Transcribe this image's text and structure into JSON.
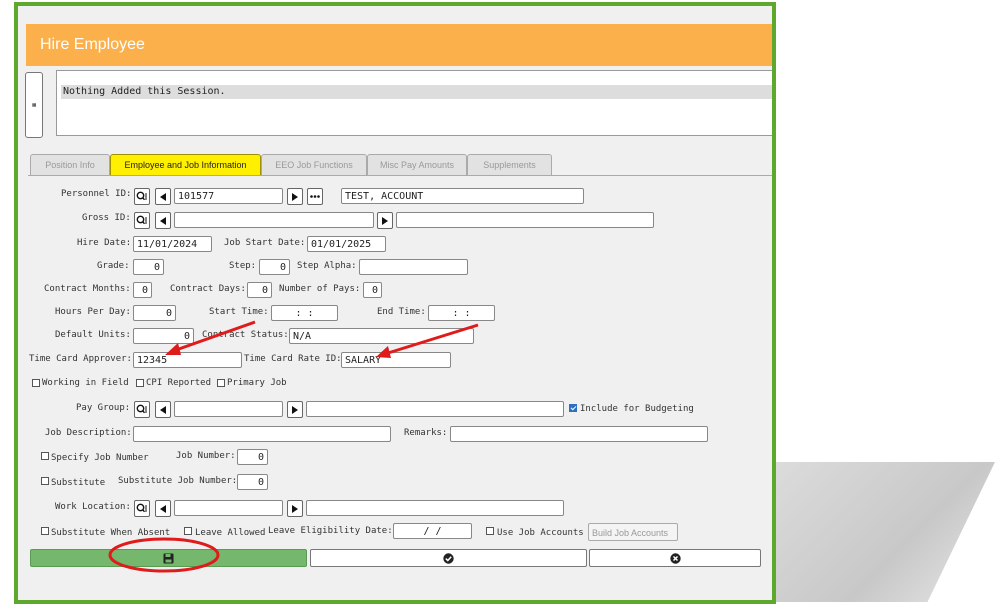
{
  "window": {
    "title": "Hire Employee"
  },
  "session": {
    "message": "Nothing Added this Session."
  },
  "tabs": [
    {
      "label": "Position Info",
      "active": false
    },
    {
      "label": "Employee and Job Information",
      "active": true
    },
    {
      "label": "EEO Job Functions",
      "active": false
    },
    {
      "label": "Misc Pay Amounts",
      "active": false
    },
    {
      "label": "Supplements",
      "active": false
    }
  ],
  "form": {
    "personnel_id": {
      "label": "Personnel ID:",
      "value": "101577",
      "name_value": "TEST, ACCOUNT"
    },
    "gross_id": {
      "label": "Gross ID:",
      "value": "",
      "desc": ""
    },
    "hire_date": {
      "label": "Hire Date:",
      "value": "11/01/2024"
    },
    "job_start_date": {
      "label": "Job Start Date:",
      "value": "01/01/2025"
    },
    "grade": {
      "label": "Grade:",
      "value": "0"
    },
    "step": {
      "label": "Step:",
      "value": "0"
    },
    "step_alpha": {
      "label": "Step Alpha:",
      "value": ""
    },
    "contract_months": {
      "label": "Contract Months:",
      "value": "0"
    },
    "contract_days": {
      "label": "Contract Days:",
      "value": "0"
    },
    "number_of_pays": {
      "label": "Number of Pays:",
      "value": "0"
    },
    "hours_per_day": {
      "label": "Hours Per Day:",
      "value": "0"
    },
    "start_time": {
      "label": "Start Time:",
      "value": ":   :"
    },
    "end_time": {
      "label": "End Time:",
      "value": ":   :"
    },
    "default_units": {
      "label": "Default Units:",
      "value": "0"
    },
    "contract_status": {
      "label": "Contract Status:",
      "value": "N/A"
    },
    "time_card_approver": {
      "label": "Time Card Approver:",
      "value": "12345"
    },
    "time_card_rate_id": {
      "label": "Time Card Rate ID:",
      "value": "SALARY"
    },
    "working_in_field": {
      "label": "Working in Field",
      "checked": false
    },
    "cpi_reported": {
      "label": "CPI Reported",
      "checked": false
    },
    "primary_job": {
      "label": "Primary Job",
      "checked": false
    },
    "pay_group": {
      "label": "Pay Group:",
      "value": "",
      "desc": ""
    },
    "include_for_budgeting": {
      "label": "Include for Budgeting",
      "checked": true
    },
    "job_description": {
      "label": "Job Description:",
      "value": ""
    },
    "remarks": {
      "label": "Remarks:",
      "value": ""
    },
    "specify_job_number": {
      "label": "Specify Job Number",
      "checked": false
    },
    "job_number": {
      "label": "Job Number:",
      "value": "0"
    },
    "substitute": {
      "label": "Substitute",
      "checked": false
    },
    "substitute_job_number": {
      "label": "Substitute Job Number:",
      "value": "0"
    },
    "work_location": {
      "label": "Work Location:",
      "value": "",
      "desc": ""
    },
    "substitute_when_absent": {
      "label": "Substitute When Absent",
      "checked": false
    },
    "leave_allowed": {
      "label": "Leave Allowed",
      "checked": false
    },
    "leave_eligibility_date": {
      "label": "Leave Eligibility Date:",
      "value": "/   /"
    },
    "use_job_accounts": {
      "label": "Use Job Accounts",
      "checked": false
    },
    "build_job_accounts": {
      "placeholder": "Build Job Accounts"
    }
  },
  "icons": {
    "menu": "list-icon",
    "lookup": "search-list-icon",
    "prev": "triangle-left-icon",
    "next": "triangle-right-icon",
    "more": "ellipsis-icon",
    "save": "floppy-disk-icon",
    "confirm": "check-circle-icon",
    "cancel": "x-circle-icon"
  },
  "colors": {
    "frame": "#5fa82e",
    "titlebar": "#fbb04b",
    "active_tab": "#ffef00",
    "save_button": "#74b76d",
    "annotation": "#e01b1b"
  }
}
